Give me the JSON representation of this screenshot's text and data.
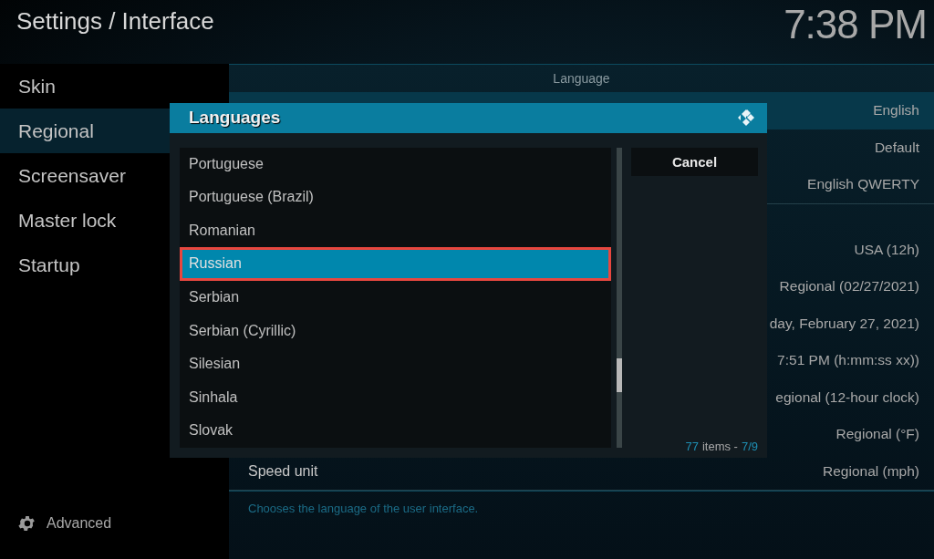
{
  "header": {
    "title": "Settings / Interface",
    "clock": "7:38 PM"
  },
  "sidebar": {
    "items": [
      {
        "label": "Skin",
        "selected": false
      },
      {
        "label": "Regional",
        "selected": true
      },
      {
        "label": "Screensaver",
        "selected": false
      },
      {
        "label": "Master lock",
        "selected": false
      },
      {
        "label": "Startup",
        "selected": false
      }
    ],
    "advanced": "Advanced"
  },
  "settings": {
    "groups": [
      {
        "title": "Language",
        "rows": [
          {
            "value": "English",
            "selected": true
          },
          {
            "value": "Default",
            "selected": false
          },
          {
            "value": "English QWERTY",
            "selected": false
          }
        ]
      },
      {
        "rows": [
          {
            "value": "USA (12h)",
            "selected": false
          },
          {
            "value": "Regional (02/27/2021)",
            "selected": false
          },
          {
            "value": "day, February 27, 2021)",
            "selected": false
          },
          {
            "value": "7:51 PM (h:mm:ss xx))",
            "selected": false
          },
          {
            "value": "egional (12-hour clock)",
            "selected": false
          },
          {
            "value": "Regional (°F)",
            "selected": false
          },
          {
            "label": "Speed unit",
            "value": "Regional (mph)",
            "selected": false
          }
        ]
      }
    ],
    "description": "Chooses the language of the user interface."
  },
  "dialog": {
    "title": "Languages",
    "items": [
      {
        "label": "Portuguese",
        "selected": false
      },
      {
        "label": "Portuguese (Brazil)",
        "selected": false
      },
      {
        "label": "Romanian",
        "selected": false
      },
      {
        "label": "Russian",
        "selected": true
      },
      {
        "label": "Serbian",
        "selected": false
      },
      {
        "label": "Serbian (Cyrillic)",
        "selected": false
      },
      {
        "label": "Silesian",
        "selected": false
      },
      {
        "label": "Sinhala",
        "selected": false
      },
      {
        "label": "Slovak",
        "selected": false
      }
    ],
    "buttons": [
      "Cancel"
    ],
    "footer": {
      "count": "77",
      "word": "items -",
      "page": "7/9"
    }
  }
}
